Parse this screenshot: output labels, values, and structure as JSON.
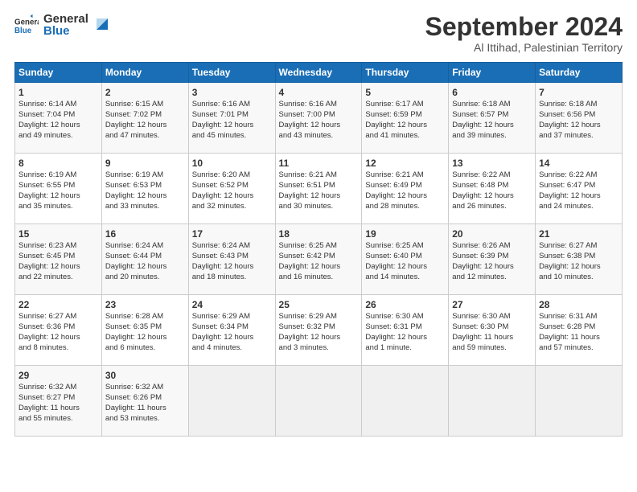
{
  "header": {
    "logo_general": "General",
    "logo_blue": "Blue",
    "title": "September 2024",
    "subtitle": "Al Ittihad, Palestinian Territory"
  },
  "days_of_week": [
    "Sunday",
    "Monday",
    "Tuesday",
    "Wednesday",
    "Thursday",
    "Friday",
    "Saturday"
  ],
  "weeks": [
    [
      {
        "day": "1",
        "lines": [
          "Sunrise: 6:14 AM",
          "Sunset: 7:04 PM",
          "Daylight: 12 hours",
          "and 49 minutes."
        ]
      },
      {
        "day": "2",
        "lines": [
          "Sunrise: 6:15 AM",
          "Sunset: 7:02 PM",
          "Daylight: 12 hours",
          "and 47 minutes."
        ]
      },
      {
        "day": "3",
        "lines": [
          "Sunrise: 6:16 AM",
          "Sunset: 7:01 PM",
          "Daylight: 12 hours",
          "and 45 minutes."
        ]
      },
      {
        "day": "4",
        "lines": [
          "Sunrise: 6:16 AM",
          "Sunset: 7:00 PM",
          "Daylight: 12 hours",
          "and 43 minutes."
        ]
      },
      {
        "day": "5",
        "lines": [
          "Sunrise: 6:17 AM",
          "Sunset: 6:59 PM",
          "Daylight: 12 hours",
          "and 41 minutes."
        ]
      },
      {
        "day": "6",
        "lines": [
          "Sunrise: 6:18 AM",
          "Sunset: 6:57 PM",
          "Daylight: 12 hours",
          "and 39 minutes."
        ]
      },
      {
        "day": "7",
        "lines": [
          "Sunrise: 6:18 AM",
          "Sunset: 6:56 PM",
          "Daylight: 12 hours",
          "and 37 minutes."
        ]
      }
    ],
    [
      {
        "day": "8",
        "lines": [
          "Sunrise: 6:19 AM",
          "Sunset: 6:55 PM",
          "Daylight: 12 hours",
          "and 35 minutes."
        ]
      },
      {
        "day": "9",
        "lines": [
          "Sunrise: 6:19 AM",
          "Sunset: 6:53 PM",
          "Daylight: 12 hours",
          "and 33 minutes."
        ]
      },
      {
        "day": "10",
        "lines": [
          "Sunrise: 6:20 AM",
          "Sunset: 6:52 PM",
          "Daylight: 12 hours",
          "and 32 minutes."
        ]
      },
      {
        "day": "11",
        "lines": [
          "Sunrise: 6:21 AM",
          "Sunset: 6:51 PM",
          "Daylight: 12 hours",
          "and 30 minutes."
        ]
      },
      {
        "day": "12",
        "lines": [
          "Sunrise: 6:21 AM",
          "Sunset: 6:49 PM",
          "Daylight: 12 hours",
          "and 28 minutes."
        ]
      },
      {
        "day": "13",
        "lines": [
          "Sunrise: 6:22 AM",
          "Sunset: 6:48 PM",
          "Daylight: 12 hours",
          "and 26 minutes."
        ]
      },
      {
        "day": "14",
        "lines": [
          "Sunrise: 6:22 AM",
          "Sunset: 6:47 PM",
          "Daylight: 12 hours",
          "and 24 minutes."
        ]
      }
    ],
    [
      {
        "day": "15",
        "lines": [
          "Sunrise: 6:23 AM",
          "Sunset: 6:45 PM",
          "Daylight: 12 hours",
          "and 22 minutes."
        ]
      },
      {
        "day": "16",
        "lines": [
          "Sunrise: 6:24 AM",
          "Sunset: 6:44 PM",
          "Daylight: 12 hours",
          "and 20 minutes."
        ]
      },
      {
        "day": "17",
        "lines": [
          "Sunrise: 6:24 AM",
          "Sunset: 6:43 PM",
          "Daylight: 12 hours",
          "and 18 minutes."
        ]
      },
      {
        "day": "18",
        "lines": [
          "Sunrise: 6:25 AM",
          "Sunset: 6:42 PM",
          "Daylight: 12 hours",
          "and 16 minutes."
        ]
      },
      {
        "day": "19",
        "lines": [
          "Sunrise: 6:25 AM",
          "Sunset: 6:40 PM",
          "Daylight: 12 hours",
          "and 14 minutes."
        ]
      },
      {
        "day": "20",
        "lines": [
          "Sunrise: 6:26 AM",
          "Sunset: 6:39 PM",
          "Daylight: 12 hours",
          "and 12 minutes."
        ]
      },
      {
        "day": "21",
        "lines": [
          "Sunrise: 6:27 AM",
          "Sunset: 6:38 PM",
          "Daylight: 12 hours",
          "and 10 minutes."
        ]
      }
    ],
    [
      {
        "day": "22",
        "lines": [
          "Sunrise: 6:27 AM",
          "Sunset: 6:36 PM",
          "Daylight: 12 hours",
          "and 8 minutes."
        ]
      },
      {
        "day": "23",
        "lines": [
          "Sunrise: 6:28 AM",
          "Sunset: 6:35 PM",
          "Daylight: 12 hours",
          "and 6 minutes."
        ]
      },
      {
        "day": "24",
        "lines": [
          "Sunrise: 6:29 AM",
          "Sunset: 6:34 PM",
          "Daylight: 12 hours",
          "and 4 minutes."
        ]
      },
      {
        "day": "25",
        "lines": [
          "Sunrise: 6:29 AM",
          "Sunset: 6:32 PM",
          "Daylight: 12 hours",
          "and 3 minutes."
        ]
      },
      {
        "day": "26",
        "lines": [
          "Sunrise: 6:30 AM",
          "Sunset: 6:31 PM",
          "Daylight: 12 hours",
          "and 1 minute."
        ]
      },
      {
        "day": "27",
        "lines": [
          "Sunrise: 6:30 AM",
          "Sunset: 6:30 PM",
          "Daylight: 11 hours",
          "and 59 minutes."
        ]
      },
      {
        "day": "28",
        "lines": [
          "Sunrise: 6:31 AM",
          "Sunset: 6:28 PM",
          "Daylight: 11 hours",
          "and 57 minutes."
        ]
      }
    ],
    [
      {
        "day": "29",
        "lines": [
          "Sunrise: 6:32 AM",
          "Sunset: 6:27 PM",
          "Daylight: 11 hours",
          "and 55 minutes."
        ]
      },
      {
        "day": "30",
        "lines": [
          "Sunrise: 6:32 AM",
          "Sunset: 6:26 PM",
          "Daylight: 11 hours",
          "and 53 minutes."
        ]
      },
      null,
      null,
      null,
      null,
      null
    ]
  ]
}
